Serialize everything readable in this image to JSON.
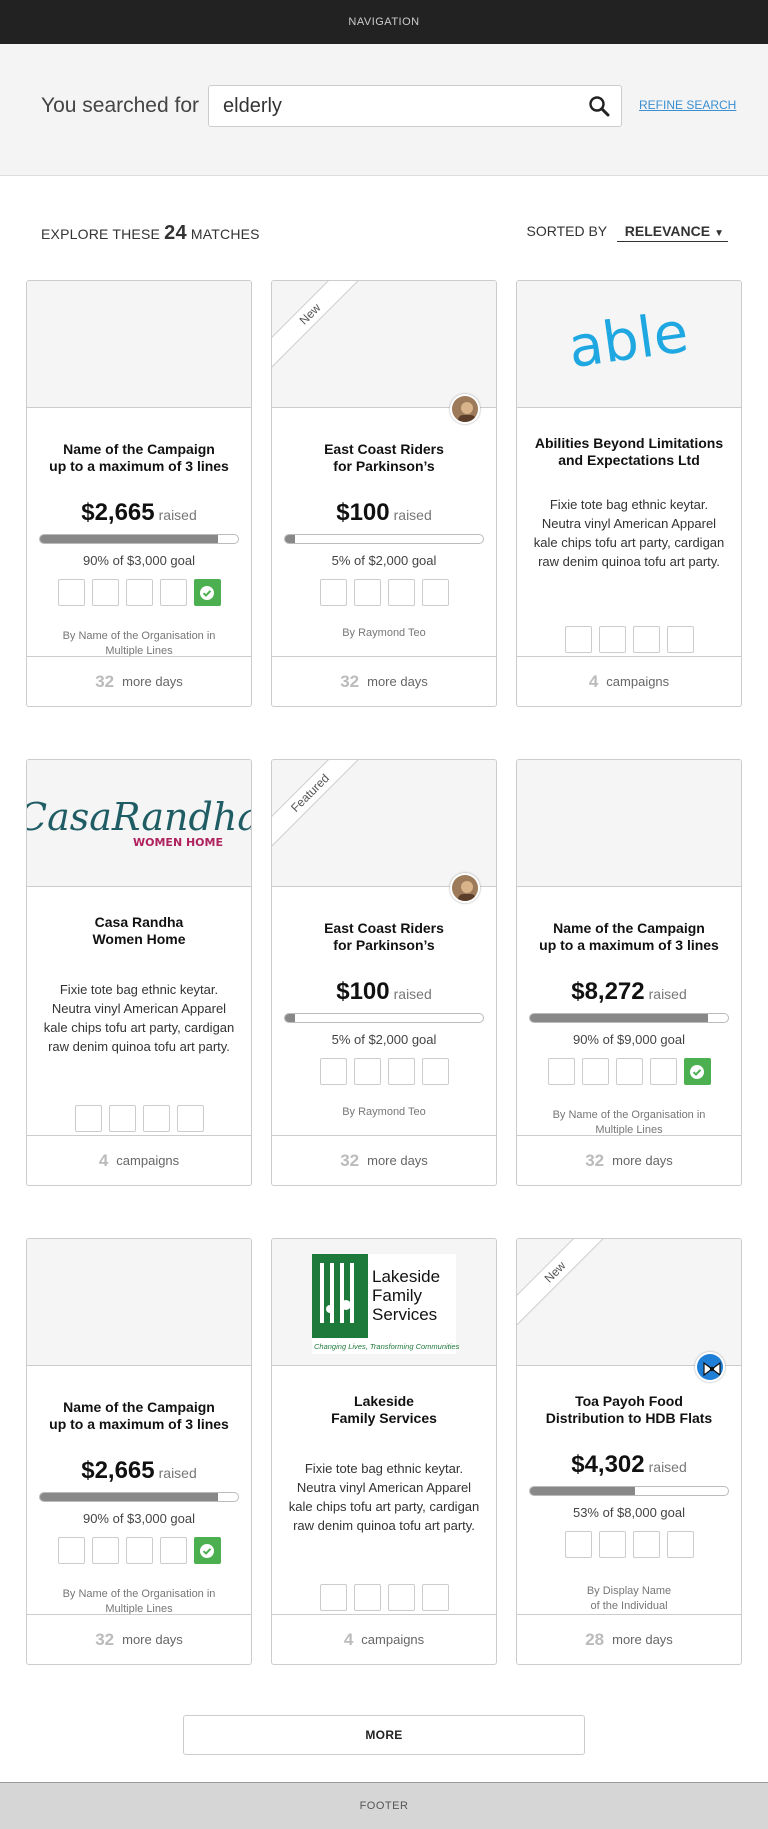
{
  "nav": {
    "label": "NAVIGATION"
  },
  "search": {
    "label": "You searched for",
    "query": "elderly",
    "refine_label": "REFINE SEARCH"
  },
  "results": {
    "prefix": "EXPLORE THESE",
    "count": "24",
    "suffix": "MATCHES",
    "sort_label": "SORTED BY",
    "sort_value": "RELEVANCE"
  },
  "cards": [
    {
      "title_1": "Name of the Campaign",
      "title_2": "up to a maximum of 3 lines",
      "amount": "$2,665",
      "raised": "raised",
      "progress": 0.9,
      "goal": "90% of $3,000 goal",
      "badges_checked": 1,
      "by_1": "By Name of the Organisation in",
      "by_2": "Multiple Lines",
      "foot_num": "32",
      "foot_label": "more days"
    },
    {
      "ribbon": "New",
      "title_1": "East Coast Riders",
      "title_2": "for Parkinson’s",
      "amount": "$100",
      "raised": "raised",
      "progress": 0.05,
      "goal": "5% of $2,000 goal",
      "by_1": "By Raymond Teo",
      "foot_num": "32",
      "foot_label": "more days"
    },
    {
      "logo": "able",
      "title_1": "Abilities Beyond Limitations",
      "title_2": "and Expectations Ltd",
      "desc": "Fixie tote bag ethnic keytar. Neutra vinyl American Apparel kale chips tofu art party, cardigan raw denim quinoa tofu art party.",
      "foot_num": "4",
      "foot_label": "campaigns"
    },
    {
      "logo_main": "CasaRandha",
      "logo_sub": "WOMEN HOME",
      "title_1": "Casa Randha",
      "title_2": "Women Home",
      "desc": "Fixie tote bag ethnic keytar. Neutra vinyl American Apparel kale chips tofu art party, cardigan raw denim quinoa tofu art party.",
      "foot_num": "4",
      "foot_label": "campaigns"
    },
    {
      "ribbon": "Featured",
      "title_1": "East Coast Riders",
      "title_2": "for Parkinson’s",
      "amount": "$100",
      "raised": "raised",
      "progress": 0.05,
      "goal": "5% of $2,000 goal",
      "by_1": "By Raymond Teo",
      "foot_num": "32",
      "foot_label": "more days"
    },
    {
      "title_1": "Name of the Campaign",
      "title_2": "up to a maximum of 3 lines",
      "amount": "$8,272",
      "raised": "raised",
      "progress": 0.9,
      "goal": "90% of $9,000 goal",
      "badges_checked": 1,
      "by_1": "By Name of the Organisation in",
      "by_2": "Multiple Lines",
      "foot_num": "32",
      "foot_label": "more days"
    },
    {
      "title_1": "Name of the Campaign",
      "title_2": "up to a maximum of 3 lines",
      "amount": "$2,665",
      "raised": "raised",
      "progress": 0.9,
      "goal": "90% of $3,000 goal",
      "badges_checked": 1,
      "by_1": "By Name of the Organisation in",
      "by_2": "Multiple Lines",
      "foot_num": "32",
      "foot_label": "more days"
    },
    {
      "logo_line1": "Lakeside",
      "logo_line2": "Family",
      "logo_line3": "Services",
      "logo_tagline": "Changing Lives, Transforming Communities",
      "title_1": "Lakeside",
      "title_2": "Family Services",
      "desc": "Fixie tote bag ethnic keytar. Neutra vinyl American Apparel kale chips tofu art party, cardigan raw denim quinoa tofu art party.",
      "foot_num": "4",
      "foot_label": "campaigns"
    },
    {
      "ribbon": "New",
      "title_1": "Toa Payoh Food",
      "title_2": "Distribution to HDB Flats",
      "amount": "$4,302",
      "raised": "raised",
      "progress": 0.53,
      "goal": "53% of $8,000 goal",
      "by_1": "By Display Name",
      "by_2": "of the Individual",
      "foot_num": "28",
      "foot_label": "more days"
    }
  ],
  "more_label": "MORE",
  "footer": {
    "label": "FOOTER"
  },
  "colors": {
    "accent_link": "#3a8fd1",
    "badge_green": "#4caf50",
    "able_blue": "#1ea7e0",
    "casa_teal": "#1f5c64",
    "casa_pink": "#b0225e",
    "lakeside_green": "#1e7a3a"
  }
}
